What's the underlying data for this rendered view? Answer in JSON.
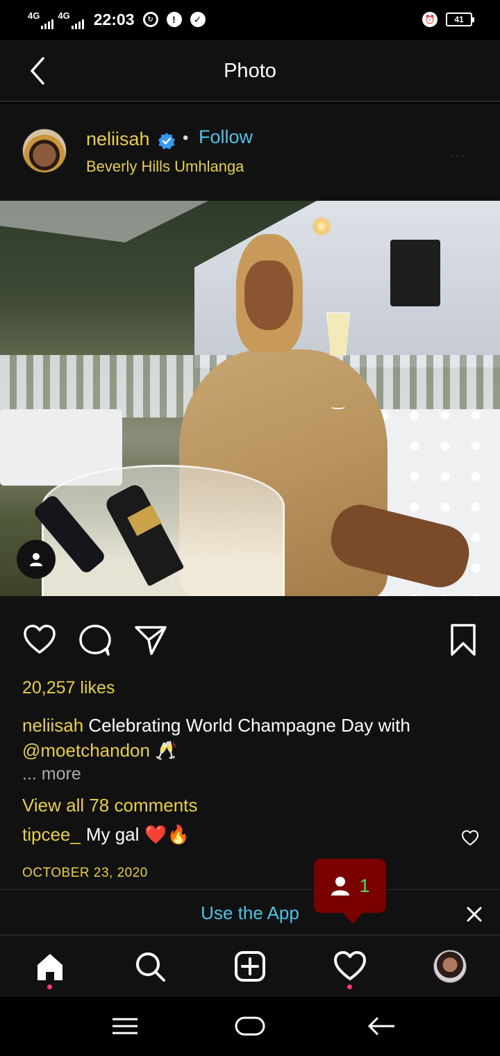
{
  "status_bar": {
    "network1": "4G",
    "network2": "4G",
    "time": "22:03",
    "battery": "41"
  },
  "header": {
    "title": "Photo"
  },
  "post": {
    "username": "neliisah",
    "follow_label": "Follow",
    "separator": "•",
    "location": "Beverly Hills Umhlanga",
    "more_label": "...",
    "likes": "20,257 likes",
    "caption_user": "neliisah",
    "caption_text": " Celebrating World Champagne Day with",
    "caption_mention": "@moetchandon",
    "caption_emoji": " 🥂",
    "more": "... more",
    "view_comments": "View all 78 comments",
    "comment_user": "tipcee_",
    "comment_text": "My gal",
    "comment_emoji": "❤️🔥",
    "date": "OCTOBER 23, 2020"
  },
  "banner": {
    "use_app": "Use the App"
  },
  "notification": {
    "count": "1"
  },
  "colors": {
    "accent_yellow": "#e8cf4a",
    "link_blue": "#4fc3e8",
    "notif_red": "#7a0000",
    "notif_green": "#4fdf57",
    "background": "#111111"
  },
  "icons": {
    "back": "chevron-left-icon",
    "verified": "verified-badge-icon",
    "like": "heart-icon",
    "comment": "comment-bubble-icon",
    "share": "send-icon",
    "save": "bookmark-icon",
    "close": "close-icon",
    "home": "home-icon",
    "search": "search-icon",
    "new_post": "plus-square-icon",
    "activity": "heart-icon",
    "nav_menu": "menu-icon",
    "nav_home": "home-pill-icon",
    "nav_back": "back-arrow-icon"
  }
}
